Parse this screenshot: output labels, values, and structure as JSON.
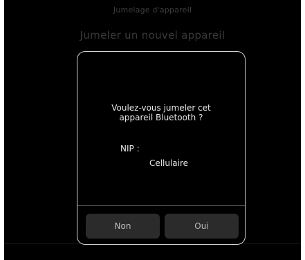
{
  "header": {
    "title": "Jumelage d'appareil"
  },
  "page": {
    "title": "Jumeler un nouvel appareil"
  },
  "dialog": {
    "message_line1": "Voulez-vous jumeler cet",
    "message_line2": "appareil Bluetooth ?",
    "pin_label": "NIP :",
    "pin_value": "Cellulaire",
    "buttons": {
      "no": "Non",
      "yes": "Oui"
    }
  },
  "colors": {
    "background": "#000000",
    "dialog_border": "#d4d4d4",
    "button_bg": "#2b2b2b",
    "text": "#e6e6e6",
    "dim_text": "#3f3f3f"
  }
}
